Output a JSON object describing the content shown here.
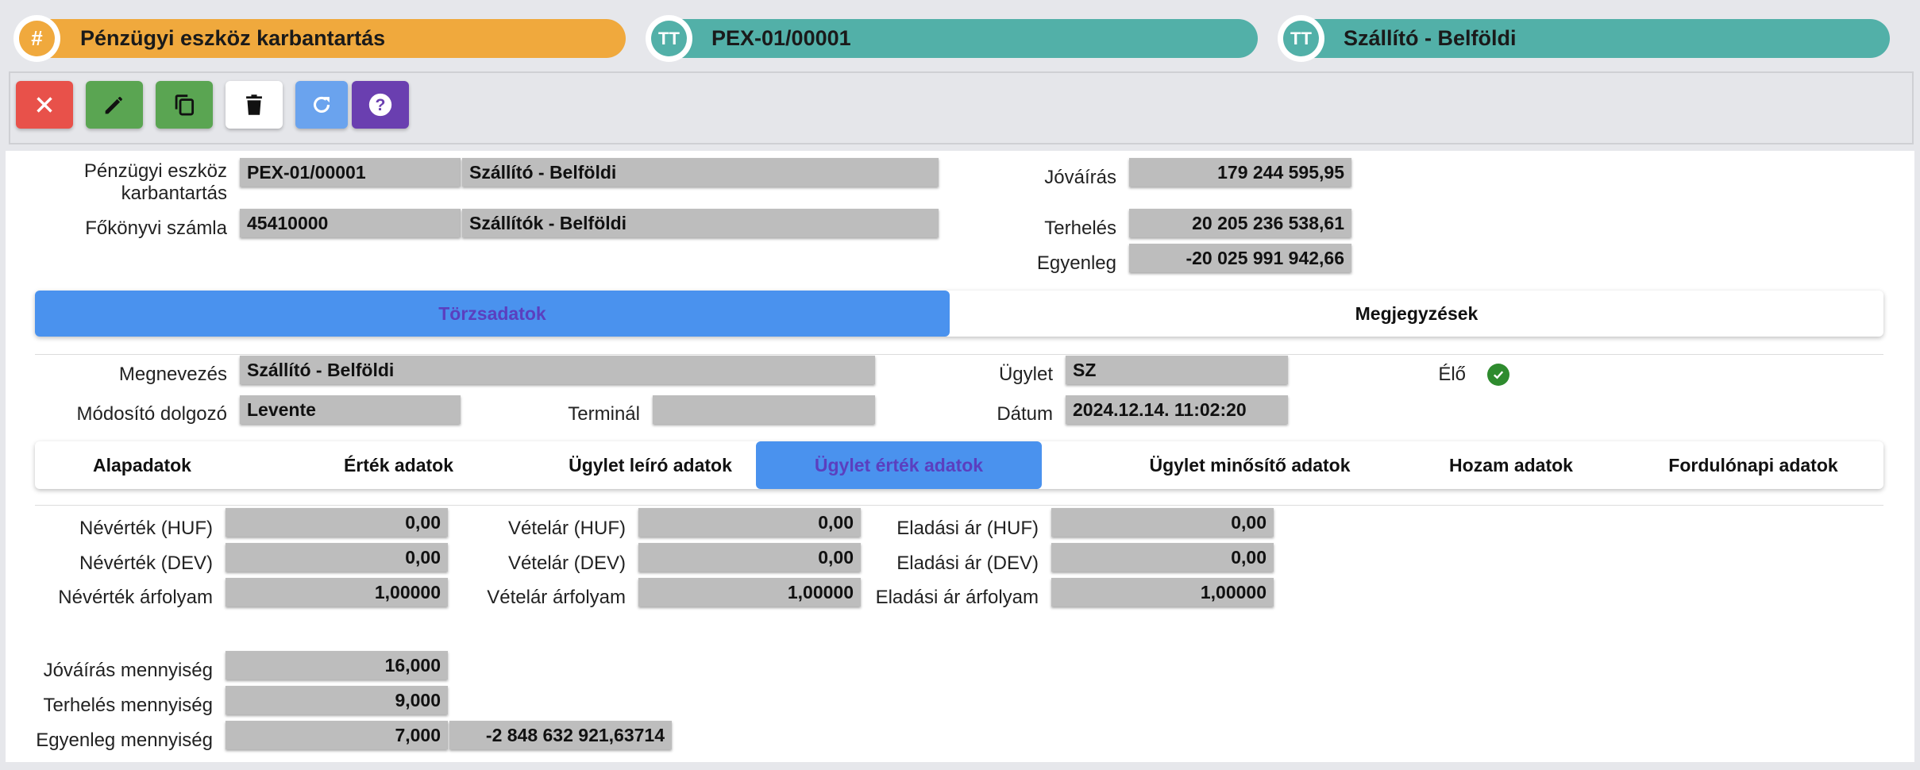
{
  "header": {
    "title_pill": "Pénzügyi eszköz karbantartás",
    "title_badge": "#",
    "code_pill": "PEX-01/00001",
    "code_badge": "TT",
    "type_pill": "Szállító - Belföldi",
    "type_badge": "TT",
    "colors": {
      "orange": "#f0a93d",
      "teal": "#52b0a8"
    }
  },
  "toolbar": {
    "buttons": [
      {
        "name": "close",
        "icon": "close-icon",
        "color": "#e8514a"
      },
      {
        "name": "edit",
        "icon": "pencil-icon",
        "color": "#5aa552"
      },
      {
        "name": "copy",
        "icon": "copy-icon",
        "color": "#5aa552"
      },
      {
        "name": "delete",
        "icon": "trash-icon",
        "color": "#ffffff"
      },
      {
        "name": "refresh",
        "icon": "refresh-icon",
        "color": "#6aa3ee"
      },
      {
        "name": "help",
        "icon": "help-icon",
        "color": "#6a3fb0"
      }
    ]
  },
  "top": {
    "asset_label_1": "Pénzügyi eszköz",
    "asset_label_2": "karbantartás",
    "asset_code": "PEX-01/00001",
    "asset_name": "Szállító - Belföldi",
    "ledger_label": "Főkönyvi számla",
    "ledger_code": "45410000",
    "ledger_name": "Szállítók - Belföldi",
    "credit_label": "Jóváírás",
    "credit_value": "179 244 595,95",
    "debit_label": "Terhelés",
    "debit_value": "20 205 236 538,61",
    "balance_label": "Egyenleg",
    "balance_value": "-20 025 991 942,66"
  },
  "main_tabs": [
    {
      "label": "Törzsadatok",
      "active": true
    },
    {
      "label": "Megjegyzések",
      "active": false
    }
  ],
  "master": {
    "name_label": "Megnevezés",
    "name_value": "Szállító - Belföldi",
    "modifier_label": "Módosító dolgozó",
    "modifier_value": "Levente",
    "terminal_label": "Terminál",
    "terminal_value": "",
    "deal_label": "Ügylet",
    "deal_value": "SZ",
    "date_label": "Dátum",
    "date_value": "2024.12.14. 11:02:20",
    "live_label": "Élő",
    "live_checked": true
  },
  "sub_tabs": [
    {
      "label": "Alapadatok",
      "active": false
    },
    {
      "label": "Érték adatok",
      "active": false
    },
    {
      "label": "Ügylet leíró adatok",
      "active": false
    },
    {
      "label": "Ügylet érték adatok",
      "active": true
    },
    {
      "label": "Ügylet minősítő adatok",
      "active": false
    },
    {
      "label": "Hozam adatok",
      "active": false
    },
    {
      "label": "Fordulónapi adatok",
      "active": false
    }
  ],
  "values": {
    "nom_huf_label": "Névérték (HUF)",
    "nom_huf": "0,00",
    "nom_dev_label": "Névérték (DEV)",
    "nom_dev": "0,00",
    "nom_rate_label": "Névérték árfolyam",
    "nom_rate": "1,00000",
    "buy_huf_label": "Vételár (HUF)",
    "buy_huf": "0,00",
    "buy_dev_label": "Vételár (DEV)",
    "buy_dev": "0,00",
    "buy_rate_label": "Vételár árfolyam",
    "buy_rate": "1,00000",
    "sell_huf_label": "Eladási ár (HUF)",
    "sell_huf": "0,00",
    "sell_dev_label": "Eladási ár (DEV)",
    "sell_dev": "0,00",
    "sell_rate_label": "Eladási ár árfolyam",
    "sell_rate": "1,00000",
    "credit_qty_label": "Jóváírás mennyiség",
    "credit_qty": "16,000",
    "debit_qty_label": "Terhelés mennyiség",
    "debit_qty": "9,000",
    "balance_qty_label": "Egyenleg mennyiség",
    "balance_qty": "7,000",
    "balance_amount": "-2 848 632 921,63714"
  }
}
